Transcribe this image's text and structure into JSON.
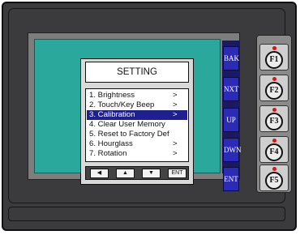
{
  "dialog": {
    "title": "SETTING",
    "items": [
      {
        "label": "1. Brightness",
        "arrow": ">",
        "selected": false
      },
      {
        "label": "2. Touch/Key Beep",
        "arrow": ">",
        "selected": false
      },
      {
        "label": "3. Calibration",
        "arrow": ">",
        "selected": true
      },
      {
        "label": "4. Clear User Memory",
        "arrow": "",
        "selected": false
      },
      {
        "label": "5. Reset to Factory Def",
        "arrow": "",
        "selected": false
      },
      {
        "label": "6. Hourglass",
        "arrow": ">",
        "selected": false
      },
      {
        "label": "7. Rotation",
        "arrow": ">",
        "selected": false
      }
    ],
    "nav": {
      "left": "◀",
      "up": "▲",
      "down": "▼",
      "enter": "ENT"
    }
  },
  "side_keys": [
    "BAK",
    "NXT",
    "UP",
    "DWN",
    "ENT"
  ],
  "function_keys": [
    "F1",
    "F2",
    "F3",
    "F4",
    "F5"
  ],
  "colors": {
    "lcd": "#2aa89b",
    "side_key": "#2b2bb5",
    "selection": "#1f1f8f",
    "led": "#d81414"
  }
}
